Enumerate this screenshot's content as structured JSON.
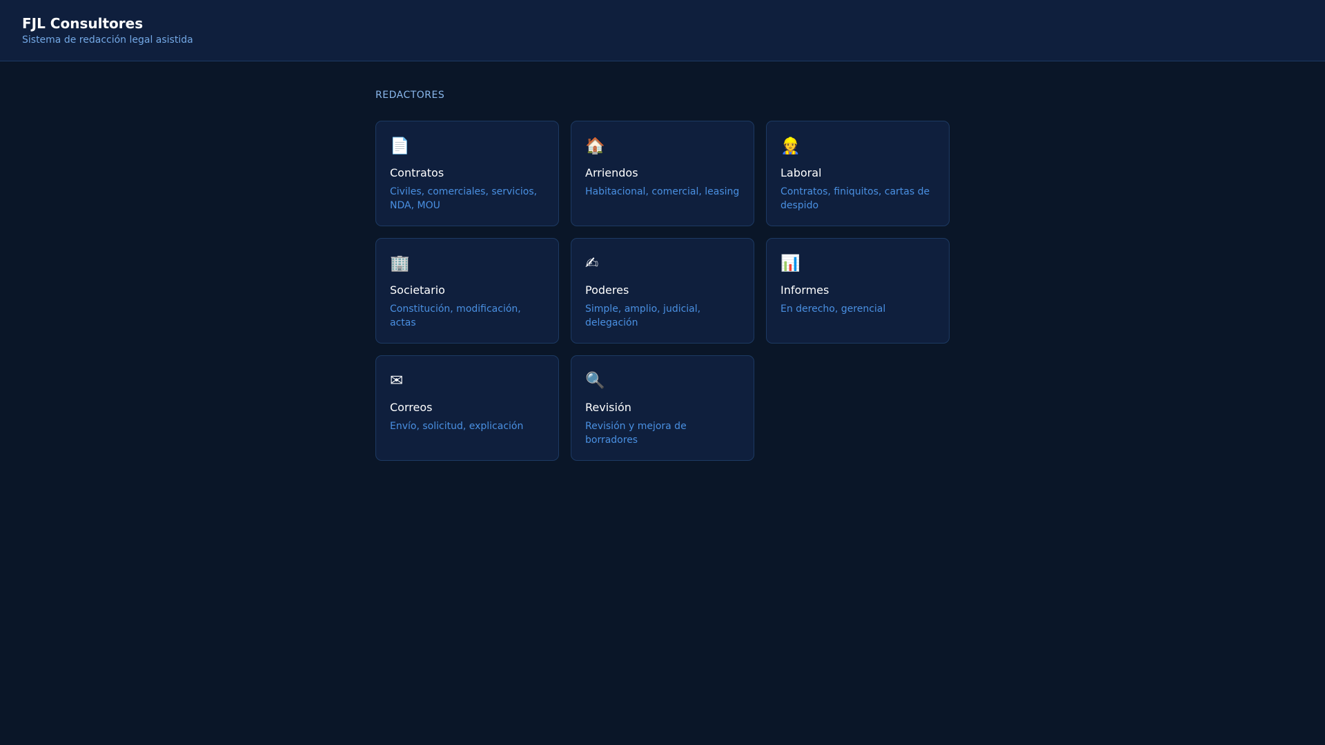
{
  "header": {
    "title": "FJL Consultores",
    "subtitle": "Sistema de redacción legal asistida"
  },
  "section_label": "REDACTORES",
  "cards": [
    {
      "icon": "📄",
      "icon_name": "document-icon",
      "title": "Contratos",
      "desc": "Civiles, comerciales, servicios, NDA, MOU"
    },
    {
      "icon": "🏠",
      "icon_name": "house-icon",
      "title": "Arriendos",
      "desc": "Habitacional, comercial, leasing"
    },
    {
      "icon": "👷",
      "icon_name": "worker-icon",
      "title": "Laboral",
      "desc": "Contratos, finiquitos, cartas de despido"
    },
    {
      "icon": "🏢",
      "icon_name": "office-building-icon",
      "title": "Societario",
      "desc": "Constitución, modificación, actas"
    },
    {
      "icon": "✍",
      "icon_name": "writing-hand-icon",
      "title": "Poderes",
      "desc": "Simple, amplio, judicial, delegación"
    },
    {
      "icon": "📊",
      "icon_name": "bar-chart-icon",
      "title": "Informes",
      "desc": "En derecho, gerencial"
    },
    {
      "icon": "✉",
      "icon_name": "envelope-icon",
      "title": "Correos",
      "desc": "Envío, solicitud, explicación"
    },
    {
      "icon": "🔍",
      "icon_name": "magnifier-icon",
      "title": "Revisión",
      "desc": "Revisión y mejora de borradores"
    }
  ]
}
